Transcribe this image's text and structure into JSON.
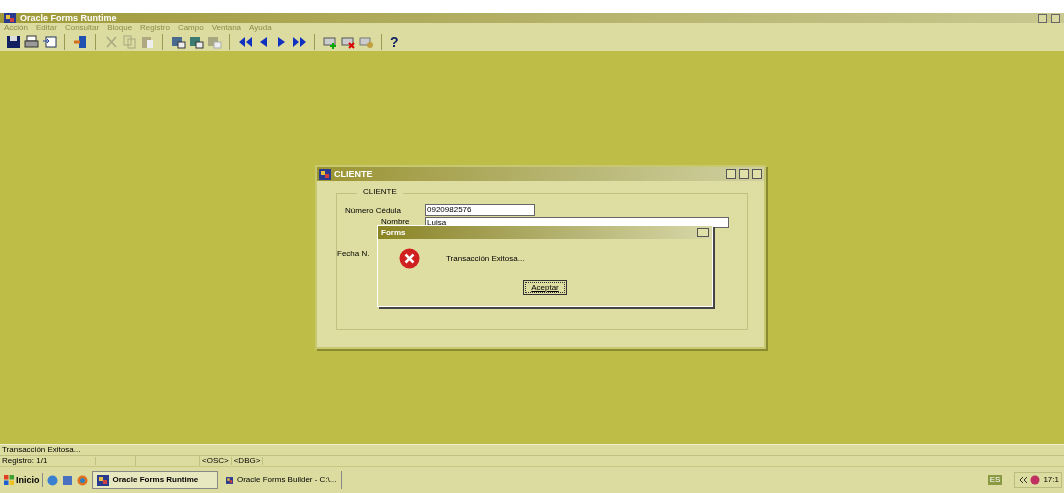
{
  "window": {
    "title": "Oracle Forms Runtime"
  },
  "menu": [
    {
      "label": "Acción",
      "disabled": true
    },
    {
      "label": "Editar",
      "disabled": true
    },
    {
      "label": "Consultar",
      "disabled": true
    },
    {
      "label": "Bloque",
      "disabled": true
    },
    {
      "label": "Registro",
      "disabled": true
    },
    {
      "label": "Campo",
      "disabled": true
    },
    {
      "label": "Ventana",
      "disabled": true
    },
    {
      "label": "Ayuda",
      "disabled": true
    }
  ],
  "toolbar": {
    "help": "?"
  },
  "client_window": {
    "title": "CLIENTE",
    "group_title": "CLIENTE",
    "fields": [
      {
        "label": "Número Cédula",
        "value": "0920982576"
      },
      {
        "label": "Nombre",
        "value": "Luisa"
      },
      {
        "label": "Fecha N."
      }
    ]
  },
  "dialog": {
    "title": "Forms",
    "message": "Transacción Exitosa...",
    "button": "Aceptar"
  },
  "status": {
    "message": "Transacción Exitosa...",
    "record": "Registro: 1/1",
    "osc": "<OSC>",
    "dbg": "<DBG>"
  },
  "taskbar": {
    "start": "Inicio",
    "tasks": [
      {
        "label": "Oracle Forms Runtime",
        "selected": true
      },
      {
        "label": "Oracle Forms Builder - C:\\...",
        "selected": false
      }
    ],
    "language": "ES",
    "time": "17:1"
  }
}
